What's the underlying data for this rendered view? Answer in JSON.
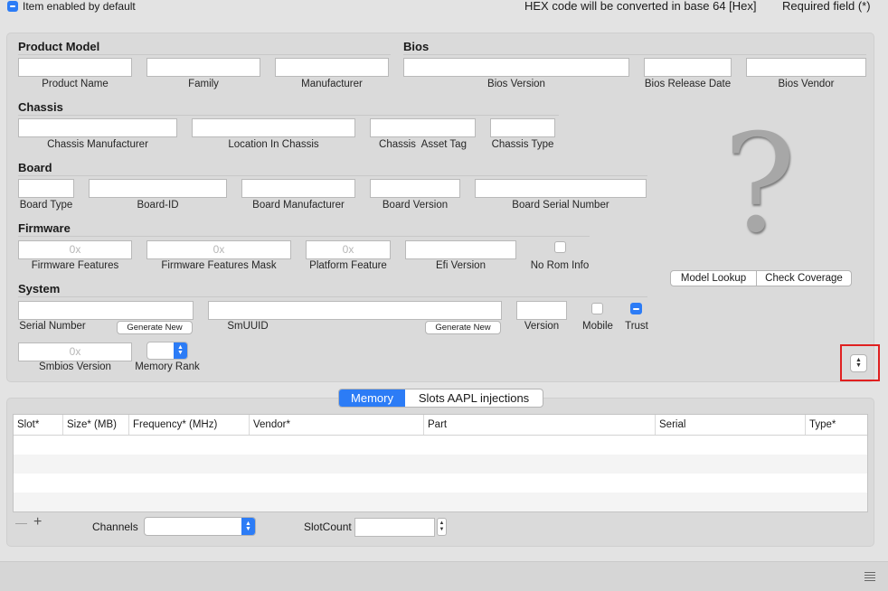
{
  "top": {
    "enabled_label": "Item enabled by default",
    "hex_note": "HEX code will be converted in base 64 [Hex]",
    "required_note": "Required field (*)"
  },
  "product_model": {
    "title": "Product Model",
    "product_name": {
      "label": "Product Name",
      "value": ""
    },
    "family": {
      "label": "Family",
      "value": ""
    },
    "manufacturer": {
      "label": "Manufacturer",
      "value": ""
    }
  },
  "bios": {
    "title": "Bios",
    "version": {
      "label": "Bios Version",
      "value": ""
    },
    "release_date": {
      "label": "Bios Release Date",
      "value": ""
    },
    "vendor": {
      "label": "Bios Vendor",
      "value": ""
    }
  },
  "chassis": {
    "title": "Chassis",
    "manufacturer": {
      "label": "Chassis Manufacturer",
      "value": ""
    },
    "location": {
      "label": "Location In Chassis",
      "value": ""
    },
    "asset_tag": {
      "label": "Chassis  Asset Tag",
      "value": ""
    },
    "type": {
      "label": "Chassis Type",
      "value": ""
    }
  },
  "board": {
    "title": "Board",
    "type": {
      "label": "Board Type",
      "value": ""
    },
    "id": {
      "label": "Board-ID",
      "value": ""
    },
    "manufacturer": {
      "label": "Board Manufacturer",
      "value": ""
    },
    "version": {
      "label": "Board Version",
      "value": ""
    },
    "serial": {
      "label": "Board Serial Number",
      "value": ""
    }
  },
  "firmware": {
    "title": "Firmware",
    "features": {
      "label": "Firmware Features",
      "placeholder": "0x"
    },
    "features_mask": {
      "label": "Firmware Features Mask",
      "placeholder": "0x"
    },
    "platform_feature": {
      "label": "Platform Feature",
      "placeholder": "0x"
    },
    "efi_version": {
      "label": "Efi Version",
      "value": ""
    },
    "no_rom_info": {
      "label": "No Rom Info",
      "checked": false
    }
  },
  "system": {
    "title": "System",
    "serial": {
      "label": "Serial Number",
      "value": ""
    },
    "generate_serial": "Generate New",
    "smuuid": {
      "label": "SmUUID",
      "value": ""
    },
    "generate_uuid": "Generate New",
    "version": {
      "label": "Version",
      "value": ""
    },
    "mobile": {
      "label": "Mobile",
      "checked": false
    },
    "trust": {
      "label": "Trust",
      "checked": true
    },
    "smbios_version": {
      "label": "Smbios Version",
      "placeholder": "0x"
    },
    "memory_rank": {
      "label": "Memory Rank",
      "value": ""
    }
  },
  "side": {
    "unknown_glyph": "?",
    "model_lookup": "Model Lookup",
    "check_coverage": "Check Coverage"
  },
  "tabs": [
    {
      "label": "Memory",
      "selected": true
    },
    {
      "label": "Slots AAPL injections",
      "selected": false
    }
  ],
  "table": {
    "columns": [
      "Slot*",
      "Size* (MB)",
      "Frequency* (MHz)",
      "Vendor*",
      "Part",
      "Serial",
      "Type*"
    ],
    "rows": []
  },
  "footer": {
    "remove": "—",
    "add": "+",
    "channels_label": "Channels",
    "channels_value": "",
    "slotcount_label": "SlotCount",
    "slotcount_value": ""
  },
  "colors": {
    "accent": "#2c7cf6",
    "highlight_box": "#e02020"
  }
}
